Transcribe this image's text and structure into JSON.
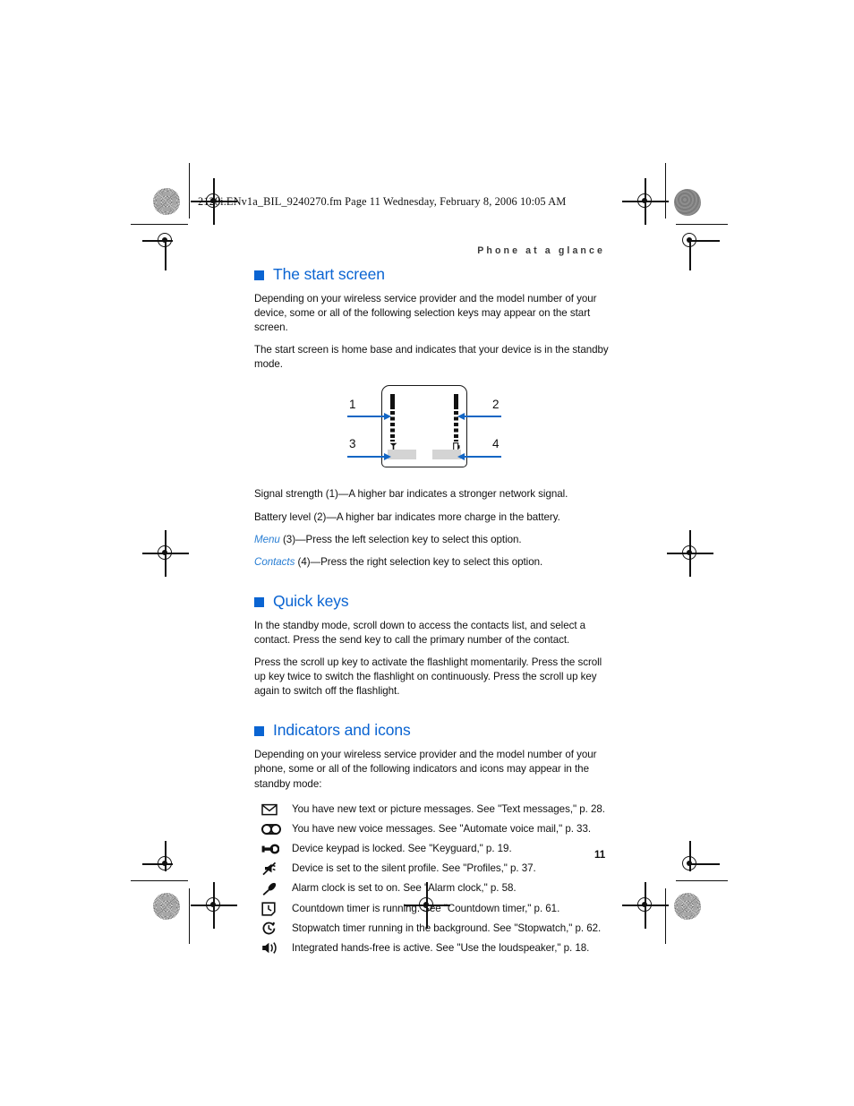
{
  "print_header": {
    "file_line": "2128i.ENv1a_BIL_9240270.fm  Page 11  Wednesday, February 8, 2006  10:05 AM"
  },
  "running_head": "Phone at a glance",
  "page_number": "11",
  "colors": {
    "heading_blue": "#0a64d2",
    "link_blue": "#2a7fd4",
    "arrow_blue": "#1366c4",
    "softkey_gray": "#d4d4d4",
    "text_black": "#111111"
  },
  "sections": [
    {
      "id": "start-screen",
      "heading": "The start screen",
      "paragraphs": [
        "Depending on your wireless service provider and the model number of your device, some or all of the following selection keys may appear on the start screen.",
        "The start screen is home base and indicates that your device is in the standby mode."
      ]
    },
    {
      "id": "quick-keys",
      "heading": "Quick keys",
      "paragraphs": [
        "In the standby mode, scroll down to access the contacts list, and select a contact. Press the send key to call the primary number of the contact.",
        "Press the scroll up key to activate the flashlight momentarily. Press the scroll up key twice to switch the flashlight on continuously. Press the scroll up key again to switch off the flashlight."
      ]
    },
    {
      "id": "indicators-and-icons",
      "heading": "Indicators and icons",
      "paragraphs": [
        "Depending on your wireless service provider and the model number of your phone, some or all of the following indicators and icons may appear in the standby mode:"
      ]
    }
  ],
  "figure": {
    "callouts": [
      {
        "number": "1",
        "position": "left-upper"
      },
      {
        "number": "2",
        "position": "right-upper"
      },
      {
        "number": "3",
        "position": "left-lower"
      },
      {
        "number": "4",
        "position": "right-lower"
      }
    ]
  },
  "figure_legend": [
    {
      "label": "",
      "text": "Signal strength (1)—A higher bar indicates a stronger network signal."
    },
    {
      "label": "",
      "text": "Battery level (2)—A higher bar indicates more charge in the battery."
    },
    {
      "label": "Menu",
      "text": " (3)—Press the left selection key to select this option."
    },
    {
      "label": "Contacts",
      "text": " (4)—Press the right selection key to select this option."
    }
  ],
  "indicator_rows": [
    {
      "icon": "envelope-icon",
      "text": "You have new text or picture messages. See \"Text messages,\" p. 28."
    },
    {
      "icon": "voicemail-icon",
      "text": "You have new voice messages. See \"Automate voice mail,\" p. 33."
    },
    {
      "icon": "key-icon",
      "text": "Device keypad is locked. See \"Keyguard,\" p. 19."
    },
    {
      "icon": "silent-profile-icon",
      "text": "Device is set to the silent profile. See \"Profiles,\" p. 37."
    },
    {
      "icon": "alarm-bell-icon",
      "text": "Alarm clock is set to on. See \"Alarm clock,\" p. 58."
    },
    {
      "icon": "countdown-timer-icon",
      "text": "Countdown timer is running. See \"Countdown timer,\" p. 61."
    },
    {
      "icon": "stopwatch-icon",
      "text": "Stopwatch timer running in the background. See \"Stopwatch,\" p. 62."
    },
    {
      "icon": "loudspeaker-icon",
      "text": "Integrated hands-free is active. See \"Use the loudspeaker,\" p. 18."
    }
  ]
}
